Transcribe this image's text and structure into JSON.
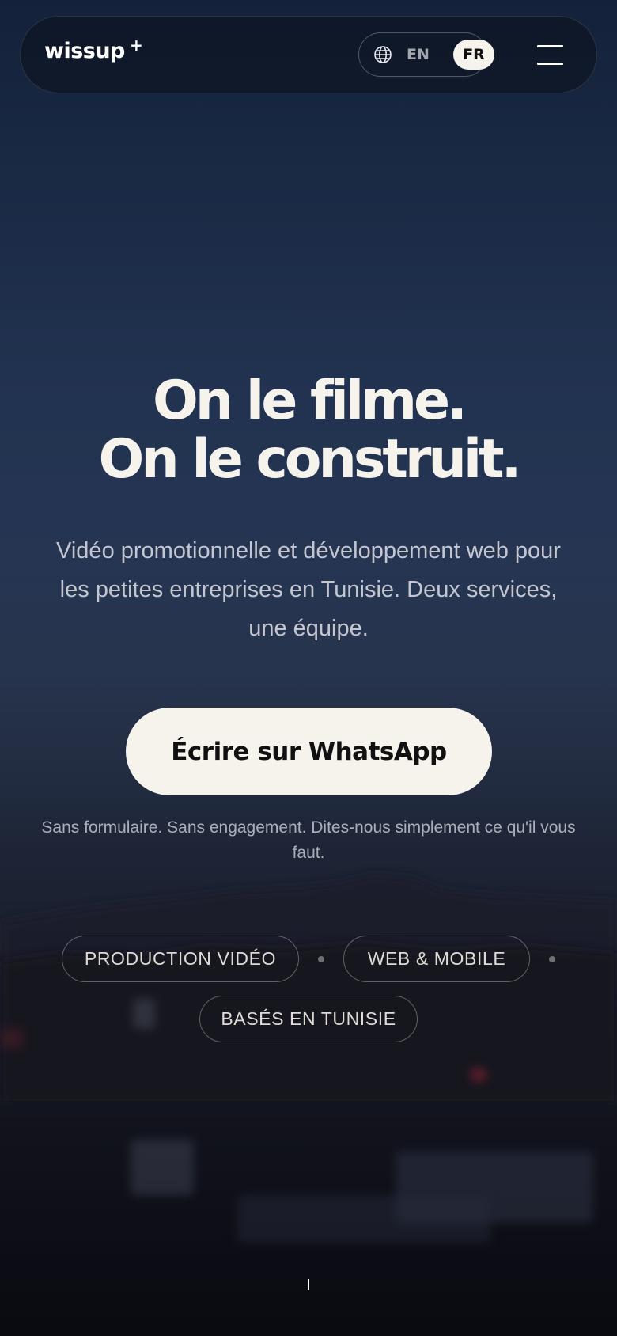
{
  "header": {
    "logo_text": "wissup",
    "logo_plus": "+",
    "language_icon": "globe-icon",
    "languages": [
      "EN",
      "FR"
    ],
    "active_language": "FR",
    "menu_icon": "hamburger-menu-icon"
  },
  "hero": {
    "title_line1": "On le filme.",
    "title_line2": "On le construit.",
    "subtitle": "Vidéo promotionnelle et développement web pour les petites entreprises en Tunisie. Deux services, une équipe.",
    "cta_label": "Écrire sur WhatsApp",
    "cta_note": "Sans formulaire. Sans engagement. Dites-nous simplement ce qu'il vous faut."
  },
  "tags": [
    "PRODUCTION VIDÉO",
    "WEB & MOBILE",
    "BASÉS EN TUNISIE"
  ],
  "colors": {
    "background_top": "#14213a",
    "background_bottom": "#0a0a11",
    "cta_background": "#f6f2ec",
    "cta_text": "#111111",
    "title_text": "#f6f2ec"
  }
}
